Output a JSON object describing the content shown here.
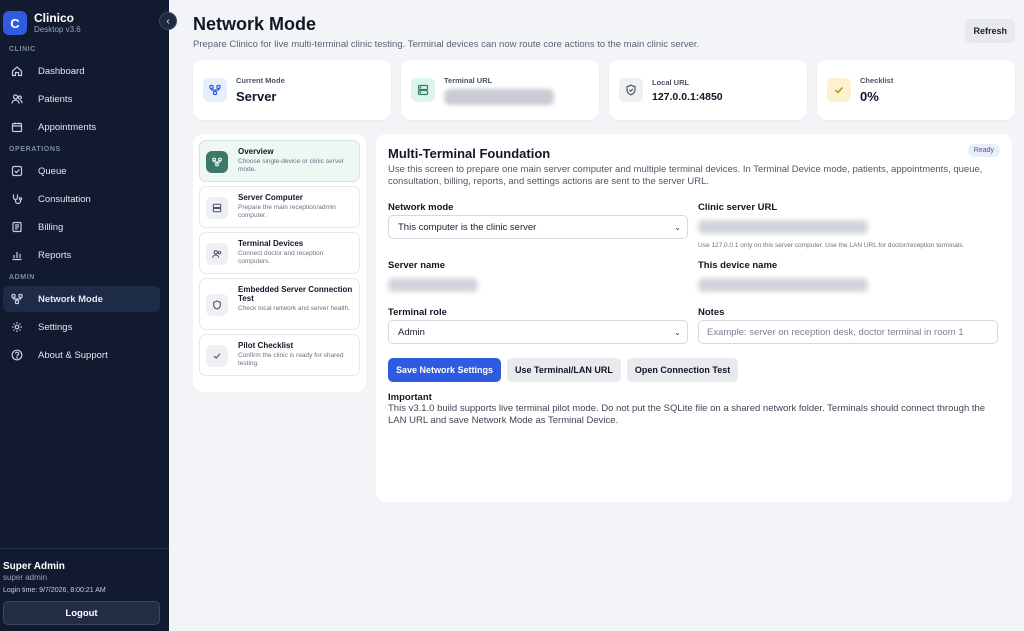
{
  "sidebar": {
    "brand": {
      "logo_letter": "C",
      "name": "Clinico",
      "version": "Desktop v3.6"
    },
    "collapse_glyph": "‹",
    "sections": [
      {
        "label": "CLINIC",
        "items": [
          {
            "label": "Dashboard",
            "icon": "home-icon"
          },
          {
            "label": "Patients",
            "icon": "users-icon"
          },
          {
            "label": "Appointments",
            "icon": "calendar-icon"
          }
        ]
      },
      {
        "label": "OPERATIONS",
        "items": [
          {
            "label": "Queue",
            "icon": "checkbox-icon"
          },
          {
            "label": "Consultation",
            "icon": "stethoscope-icon"
          },
          {
            "label": "Billing",
            "icon": "receipt-icon"
          },
          {
            "label": "Reports",
            "icon": "bar-chart-icon"
          }
        ]
      },
      {
        "label": "ADMIN",
        "items": [
          {
            "label": "Network Mode",
            "icon": "network-icon",
            "active": true
          },
          {
            "label": "Settings",
            "icon": "gear-icon"
          },
          {
            "label": "About & Support",
            "icon": "help-icon"
          }
        ]
      }
    ],
    "footer": {
      "user_name": "Super Admin",
      "user_role": "super admin",
      "login_time": "Login time: 9/7/2026, 8:00:21 AM",
      "logout_label": "Logout"
    }
  },
  "header": {
    "title": "Network Mode",
    "subtitle": "Prepare Clinico for live multi-terminal clinic testing. Terminal devices can now route core actions to the main clinic server.",
    "refresh_label": "Refresh"
  },
  "stats": {
    "current_mode": {
      "label": "Current Mode",
      "value": "Server"
    },
    "terminal_url": {
      "label": "Terminal URL",
      "value": ""
    },
    "local_url": {
      "label": "Local URL",
      "value": "127.0.0.1:4850"
    },
    "checklist": {
      "label": "Checklist",
      "value": "0%"
    }
  },
  "steps": [
    {
      "title": "Overview",
      "desc": "Choose single-device or clinic server mode.",
      "icon": "network-icon",
      "active": true
    },
    {
      "title": "Server Computer",
      "desc": "Prepare the main reception/admin computer.",
      "icon": "server-icon"
    },
    {
      "title": "Terminal Devices",
      "desc": "Connect doctor and reception computers.",
      "icon": "users-icon"
    },
    {
      "title": "Embedded Server Connection Test",
      "desc": "Check local network and server health.",
      "icon": "shield-icon"
    },
    {
      "title": "Pilot Checklist",
      "desc": "Confirm the clinic is ready for shared testing.",
      "icon": "check-icon"
    }
  ],
  "panel": {
    "title": "Multi-Terminal Foundation",
    "badge": "Ready",
    "description": "Use this screen to prepare one main server computer and multiple terminal devices. In Terminal Device mode, patients, appointments, queue, consultation, billing, reports, and settings actions are sent to the server URL.",
    "network_mode": {
      "label": "Network mode",
      "value": "This computer is the clinic server"
    },
    "clinic_server_url": {
      "label": "Clinic server URL",
      "help": "Use 127.0.0.1 only on this server computer. Use the LAN URL for doctor/reception terminals."
    },
    "server_name": {
      "label": "Server name"
    },
    "device_name": {
      "label": "This device name"
    },
    "terminal_role": {
      "label": "Terminal role",
      "value": "Admin"
    },
    "notes": {
      "label": "Notes",
      "placeholder": "Example: server on reception desk, doctor terminal in room 1"
    },
    "actions": {
      "save": "Save Network Settings",
      "use_lan": "Use Terminal/LAN URL",
      "open_test": "Open Connection Test"
    },
    "important": {
      "title": "Important",
      "text": "This v3.1.0 build supports live terminal pilot mode. Do not put the SQLite file on a shared network folder. Terminals should connect through the LAN URL and save Network Mode as Terminal Device."
    }
  },
  "colors": {
    "sidebar_bg": "#111a2e",
    "accent": "#2f5be0",
    "active_step": "#3b7a68",
    "checklist_icon_bg": "#fdf1cf"
  }
}
